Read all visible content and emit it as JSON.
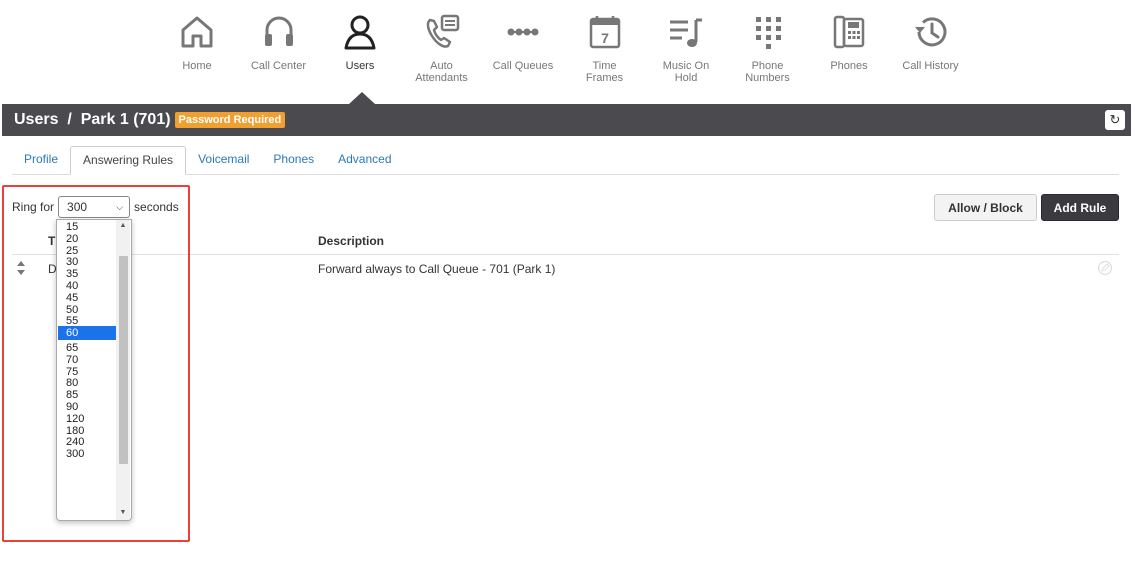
{
  "nav": [
    {
      "key": "home",
      "label": "Home",
      "icon": "home-icon"
    },
    {
      "key": "call-center",
      "label": "Call Center",
      "icon": "headset-icon"
    },
    {
      "key": "users",
      "label": "Users",
      "icon": "user-icon",
      "active": true
    },
    {
      "key": "auto-attendants",
      "label": "Auto\nAttendants",
      "icon": "phone-menu-icon"
    },
    {
      "key": "call-queues",
      "label": "Call Queues",
      "icon": "queue-icon"
    },
    {
      "key": "time-frames",
      "label": "Time\nFrames",
      "icon": "calendar-icon",
      "icon_text": "7"
    },
    {
      "key": "music-on-hold",
      "label": "Music On\nHold",
      "icon": "music-note-icon"
    },
    {
      "key": "phone-numbers",
      "label": "Phone\nNumbers",
      "icon": "keypad-icon"
    },
    {
      "key": "phones",
      "label": "Phones",
      "icon": "desk-phone-icon"
    },
    {
      "key": "call-history",
      "label": "Call History",
      "icon": "history-icon"
    }
  ],
  "header": {
    "title": "Users  /  Park 1 (701)",
    "badge": "Password Required",
    "refresh_icon": "refresh-icon"
  },
  "tabs": [
    {
      "label": "Profile",
      "active": false
    },
    {
      "label": "Answering Rules",
      "active": true
    },
    {
      "label": "Voicemail",
      "active": false
    },
    {
      "label": "Phones",
      "active": false
    },
    {
      "label": "Advanced",
      "active": false
    }
  ],
  "toolbar": {
    "ring_for_label": "Ring for",
    "ring_value": "300",
    "seconds_label": "seconds",
    "allow_block_label": "Allow / Block",
    "add_rule_label": "Add Rule"
  },
  "table": {
    "col_type": "T",
    "col_description": "Description",
    "rows": [
      {
        "type": "D",
        "description": "Forward always to Call Queue - 701 (Park 1)"
      }
    ]
  },
  "ring_options": [
    "15",
    "20",
    "25",
    "30",
    "35",
    "40",
    "45",
    "50",
    "55",
    "60",
    "65",
    "70",
    "75",
    "80",
    "85",
    "90",
    "120",
    "180",
    "240",
    "300"
  ],
  "ring_selected_highlight": "60",
  "colors": {
    "titlebar": "#4a4a4f",
    "badge": "#f0a030",
    "tab_link": "#2a7ab8",
    "selected_option": "#1a73e8",
    "highlight_border": "#e8423a"
  }
}
